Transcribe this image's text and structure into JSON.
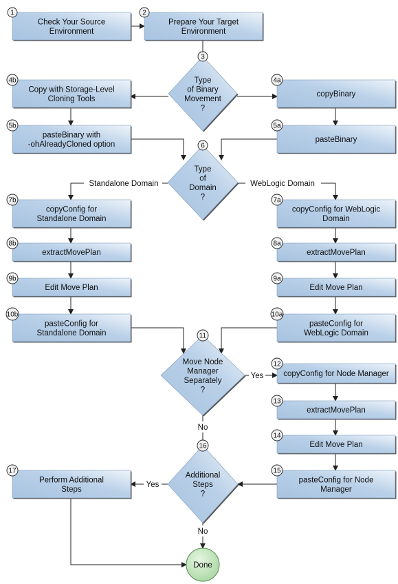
{
  "colors": {
    "box_fill_dark": "#a8c3e0",
    "box_fill_light": "#eef4fa",
    "done_fill": "#bfe3b9",
    "line": "#222222"
  },
  "nodes": {
    "n1": {
      "badge": "1",
      "lines": [
        "Check Your Source",
        "Environment"
      ]
    },
    "n2": {
      "badge": "2",
      "lines": [
        "Prepare Your Target",
        "Environment"
      ]
    },
    "n3": {
      "badge": "3",
      "lines": [
        "Type",
        "of Binary",
        "Movement",
        "?"
      ]
    },
    "n4b": {
      "badge": "4b",
      "lines": [
        "Copy with Storage-Level",
        "Cloning Tools"
      ]
    },
    "n4a": {
      "badge": "4a",
      "lines": [
        "copyBinary"
      ]
    },
    "n5b": {
      "badge": "5b",
      "lines": [
        "pasteBinary with",
        "-ohAlreadyCloned option"
      ]
    },
    "n5a": {
      "badge": "5a",
      "lines": [
        "pasteBinary"
      ]
    },
    "n6": {
      "badge": "6",
      "lines": [
        "Type",
        "of",
        "Domain",
        "?"
      ]
    },
    "n7b": {
      "badge": "7b",
      "lines": [
        "copyConfig for",
        "Standalone Domain"
      ]
    },
    "n7a": {
      "badge": "7a",
      "lines": [
        "copyConfig for WebLogic",
        "Domain"
      ]
    },
    "n8b": {
      "badge": "8b",
      "lines": [
        "extractMovePlan"
      ]
    },
    "n8a": {
      "badge": "8a",
      "lines": [
        "extractMovePlan"
      ]
    },
    "n9b": {
      "badge": "9b",
      "lines": [
        "Edit Move Plan"
      ]
    },
    "n9a": {
      "badge": "9a",
      "lines": [
        "Edit Move Plan"
      ]
    },
    "n10b": {
      "badge": "10b",
      "lines": [
        "pasteConfig for",
        "Standalone Domain"
      ]
    },
    "n10a": {
      "badge": "10a",
      "lines": [
        "pasteConfig for",
        "WebLogic Domain"
      ]
    },
    "n11": {
      "badge": "11",
      "lines": [
        "Move Node",
        "Manager",
        "Separately",
        "?"
      ]
    },
    "n12": {
      "badge": "12",
      "lines": [
        "copyConfig for Node Manager"
      ]
    },
    "n13": {
      "badge": "13",
      "lines": [
        "extractMovePlan"
      ]
    },
    "n14": {
      "badge": "14",
      "lines": [
        "Edit Move Plan"
      ]
    },
    "n15": {
      "badge": "15",
      "lines": [
        "pasteConfig for Node",
        "Manager"
      ]
    },
    "n16": {
      "badge": "16",
      "lines": [
        "Additional",
        "Steps",
        "?"
      ]
    },
    "n17": {
      "badge": "17",
      "lines": [
        "Perform Additional",
        "Steps"
      ]
    },
    "done": {
      "lines": [
        "Done"
      ]
    }
  },
  "edge_labels": {
    "standalone": "Standalone Domain",
    "weblogic": "WebLogic Domain",
    "yes_11": "Yes",
    "no_11": "No",
    "yes_16": "Yes",
    "no_16": "No"
  }
}
